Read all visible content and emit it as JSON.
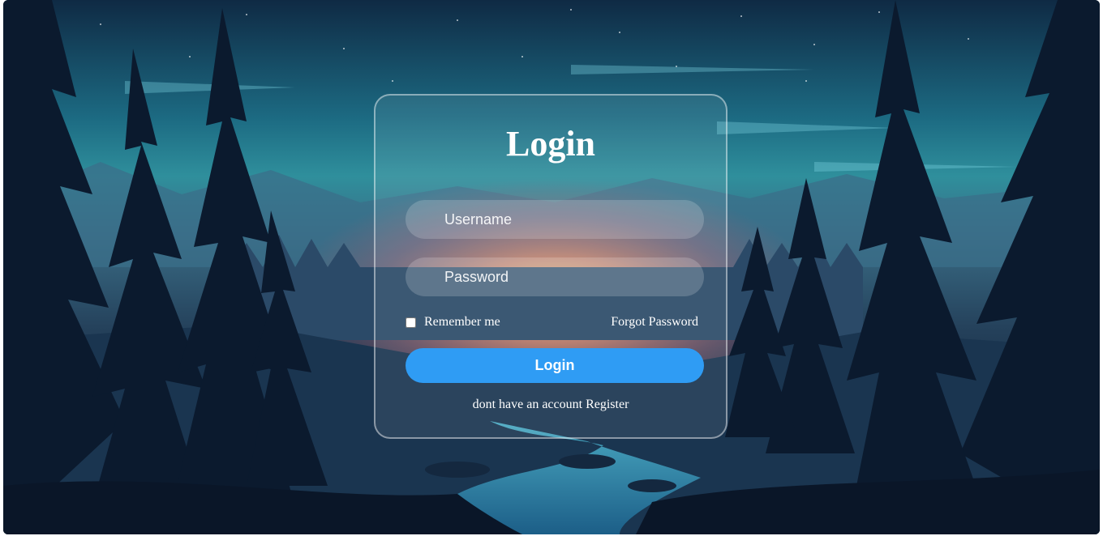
{
  "login_form": {
    "title": "Login",
    "username_placeholder": "Username",
    "password_placeholder": "Password",
    "remember_label": "Remember me",
    "remember_checked": false,
    "forgot_label": "Forgot Password",
    "submit_label": "Login",
    "register_prompt": "dont have an account",
    "register_link": "Register"
  },
  "colors": {
    "button": "#2f9cf4",
    "text": "#ffffff"
  }
}
